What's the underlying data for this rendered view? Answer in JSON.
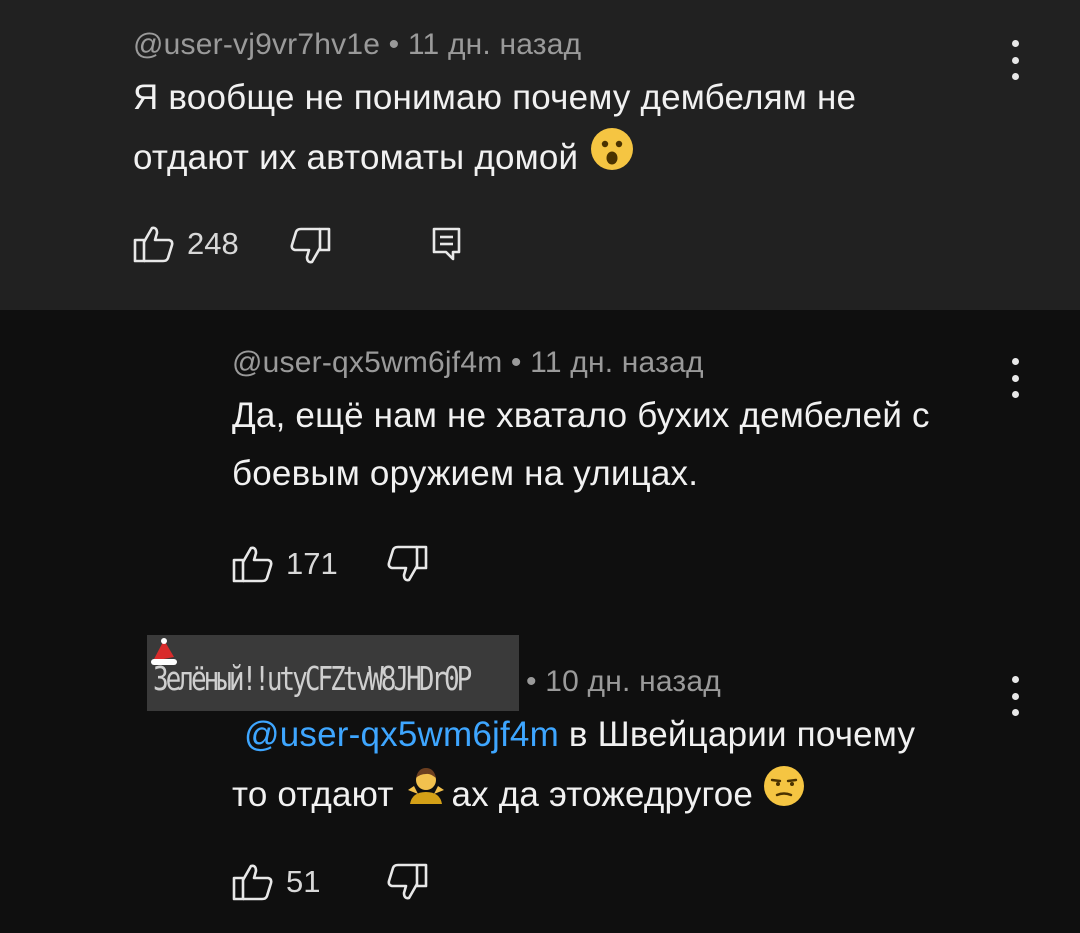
{
  "comments": [
    {
      "author": "@user-vj9vr7hv1e",
      "time": " • 11 дн. назад",
      "text_line1": "Я вообще не понимаю почему дембелям не",
      "text_line2": "отдают их автоматы домой",
      "likes": "248",
      "emoji": "astonished-face"
    },
    {
      "author": "@user-qx5wm6jf4m",
      "time": " • 11 дн. назад",
      "text_line1": "Да, ещё нам не хватало бухих дембелей с",
      "text_line2": "боевым оружием на улицах.",
      "likes": "171"
    },
    {
      "author": "Зелёный!!utyCFZtvW8JHDr0P",
      "time": "• 10 дн. назад",
      "mention": "@user-qx5wm6jf4m",
      "text_line1_rest": " в Швейцарии почему",
      "text_line2_a": "то отдают ",
      "text_line2_b": "ах да этожедругое ",
      "likes": "51",
      "emojis": [
        "person-shrugging",
        "unamused-face"
      ]
    }
  ],
  "colors": {
    "top_bg": "#212121",
    "page_bg": "#0f0f0f",
    "mention": "#3ea6ff",
    "meta": "#9a9a9a"
  },
  "icons": [
    "like-icon",
    "dislike-icon",
    "reply-icon",
    "more-options-icon"
  ]
}
